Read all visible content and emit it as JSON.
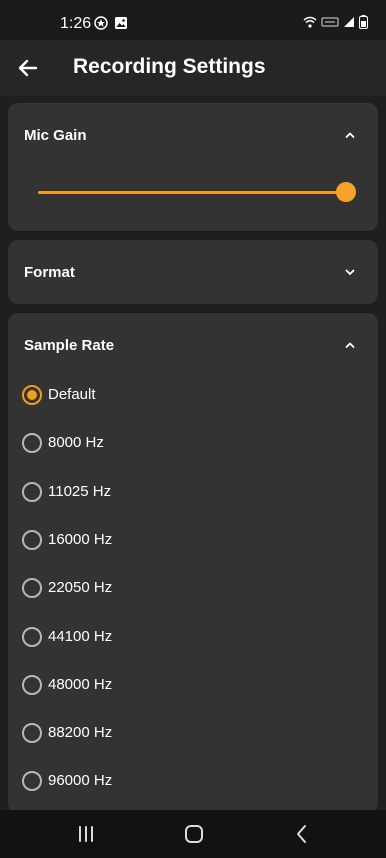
{
  "status_bar": {
    "time": "1:26"
  },
  "app_bar": {
    "title": "Recording Settings"
  },
  "mic_gain": {
    "title": "Mic Gain",
    "value_percent": 100
  },
  "format": {
    "title": "Format"
  },
  "sample_rate": {
    "title": "Sample Rate",
    "selected_index": 0,
    "options": [
      "Default",
      "8000 Hz",
      "11025 Hz",
      "16000 Hz",
      "22050 Hz",
      "44100 Hz",
      "48000 Hz",
      "88200 Hz",
      "96000 Hz"
    ]
  },
  "colors": {
    "accent": "#f29d1d",
    "card": "#333333",
    "background": "#1f1f1f"
  }
}
